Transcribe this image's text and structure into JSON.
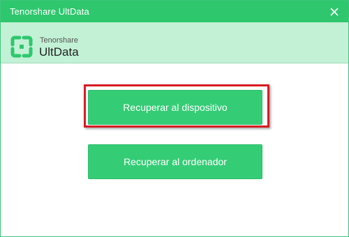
{
  "window": {
    "title": "Tenorshare UltData",
    "accent_color": "#2fc76d",
    "header_color": "#c2f1d5",
    "close_icon": "close-icon"
  },
  "logo": {
    "brand": "Tenorshare",
    "product": "UltData",
    "icon": "ultdata-logo-icon"
  },
  "actions": {
    "recover_to_device": "Recuperar al dispositivo",
    "recover_to_computer": "Recuperar al ordenador"
  },
  "annotation": {
    "highlight_color": "#d71b22"
  }
}
